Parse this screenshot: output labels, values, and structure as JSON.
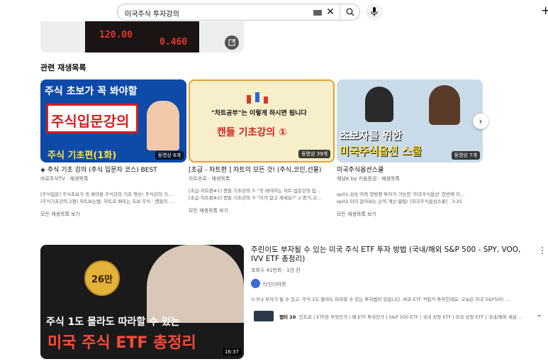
{
  "search": {
    "value": "미국주식 투자강의"
  },
  "top_thumbnail": {
    "ticker_values": [
      "120.00",
      "0.460"
    ]
  },
  "section_title": "관련 재생목록",
  "playlists": [
    {
      "title": "◈ 주식 기초 강의 (주식 입문자 코스) BEST",
      "channel": "바로주식TV · 재생목록",
      "thumb_lines": [
        "주식 초보가 꼭 봐야할",
        "주식입문강의",
        "주식 기초편(1화)"
      ],
      "badge": "동영상 6개",
      "desc": [
        "[주식입문] 주식초보가 꼭 봐야할 주식강의 기초 영상! 주식강의 기...",
        "(주식기초강의 2편) 차트보는법, 차트로 배우는 초보 주식 · 캔들의 ..."
      ],
      "view_all": "모든 재생목록 보기"
    },
    {
      "title": "[초급 - 차트편 ] 차트의 모든 것! (주식,코인,선물)",
      "channel": "차트프로 · 재생목록",
      "thumb_lines": [
        "\"차트공부\"는 이렇게 하시면 됩니다",
        "캔들 기초강의 ①"
      ],
      "badge": "동영상 39개",
      "desc": [
        "[초급-차트편#1] 캔들 기초강의 ① \"꼭 봐야하는 차트 입문강의 입...",
        "[초급-차트편#2] 캔들 기초강의 ② \"이거 알고 계세요?\" // 종가,고..."
      ],
      "view_all": "모든 재생목록 보기"
    },
    {
      "title": "미국주식옵션스쿨",
      "channel": "제남K by 키움증권 · 재생목록",
      "thumb_lines": [
        "초보자를 위한",
        "미국주식옵션 스쿨"
      ],
      "badge": "동영상 7개",
      "desc": [
        "ep01.상승·하락 양방향 투자가 가능한 '미국주식옵션' 한번에 이...",
        "ep02.미리 알아보는 손익 계산 꿀팁! [미국주식옵션스쿨] · 3:25"
      ],
      "view_all": "모든 재생목록 보기"
    }
  ],
  "video": {
    "title": "주린이도 부자될 수 있는 미국 주식 ETF 투자 방법 (국내/해외 S&P 500 - SPY, VOO, IVV ETF 총정리)",
    "meta": "조회수 41만회 · 1년 전",
    "channel": "타인더마켓",
    "description": "누구나 부자가 될 수 있고, 주식 1도 몰라도 따라할 수 있는 투자법이 있습니다. 바로 ETF 적립식 투자인데요. 오늘은 미국 S&P500 ...",
    "duration": "16:37",
    "thumb_badge": "26만",
    "thumb_lines": [
      "주식 1도 몰라도 따라할 수 있는",
      "미국 주식 ETF 총정리"
    ],
    "chapters_label": "챕터 10",
    "chapters": "인트로 | ETF란 무엇인가 | 왜 ETF 투자인가 | S&P 500 ETF | 국내 상장 ETF | 미국 상장 ETF | 국내/해외 세금 ..."
  }
}
